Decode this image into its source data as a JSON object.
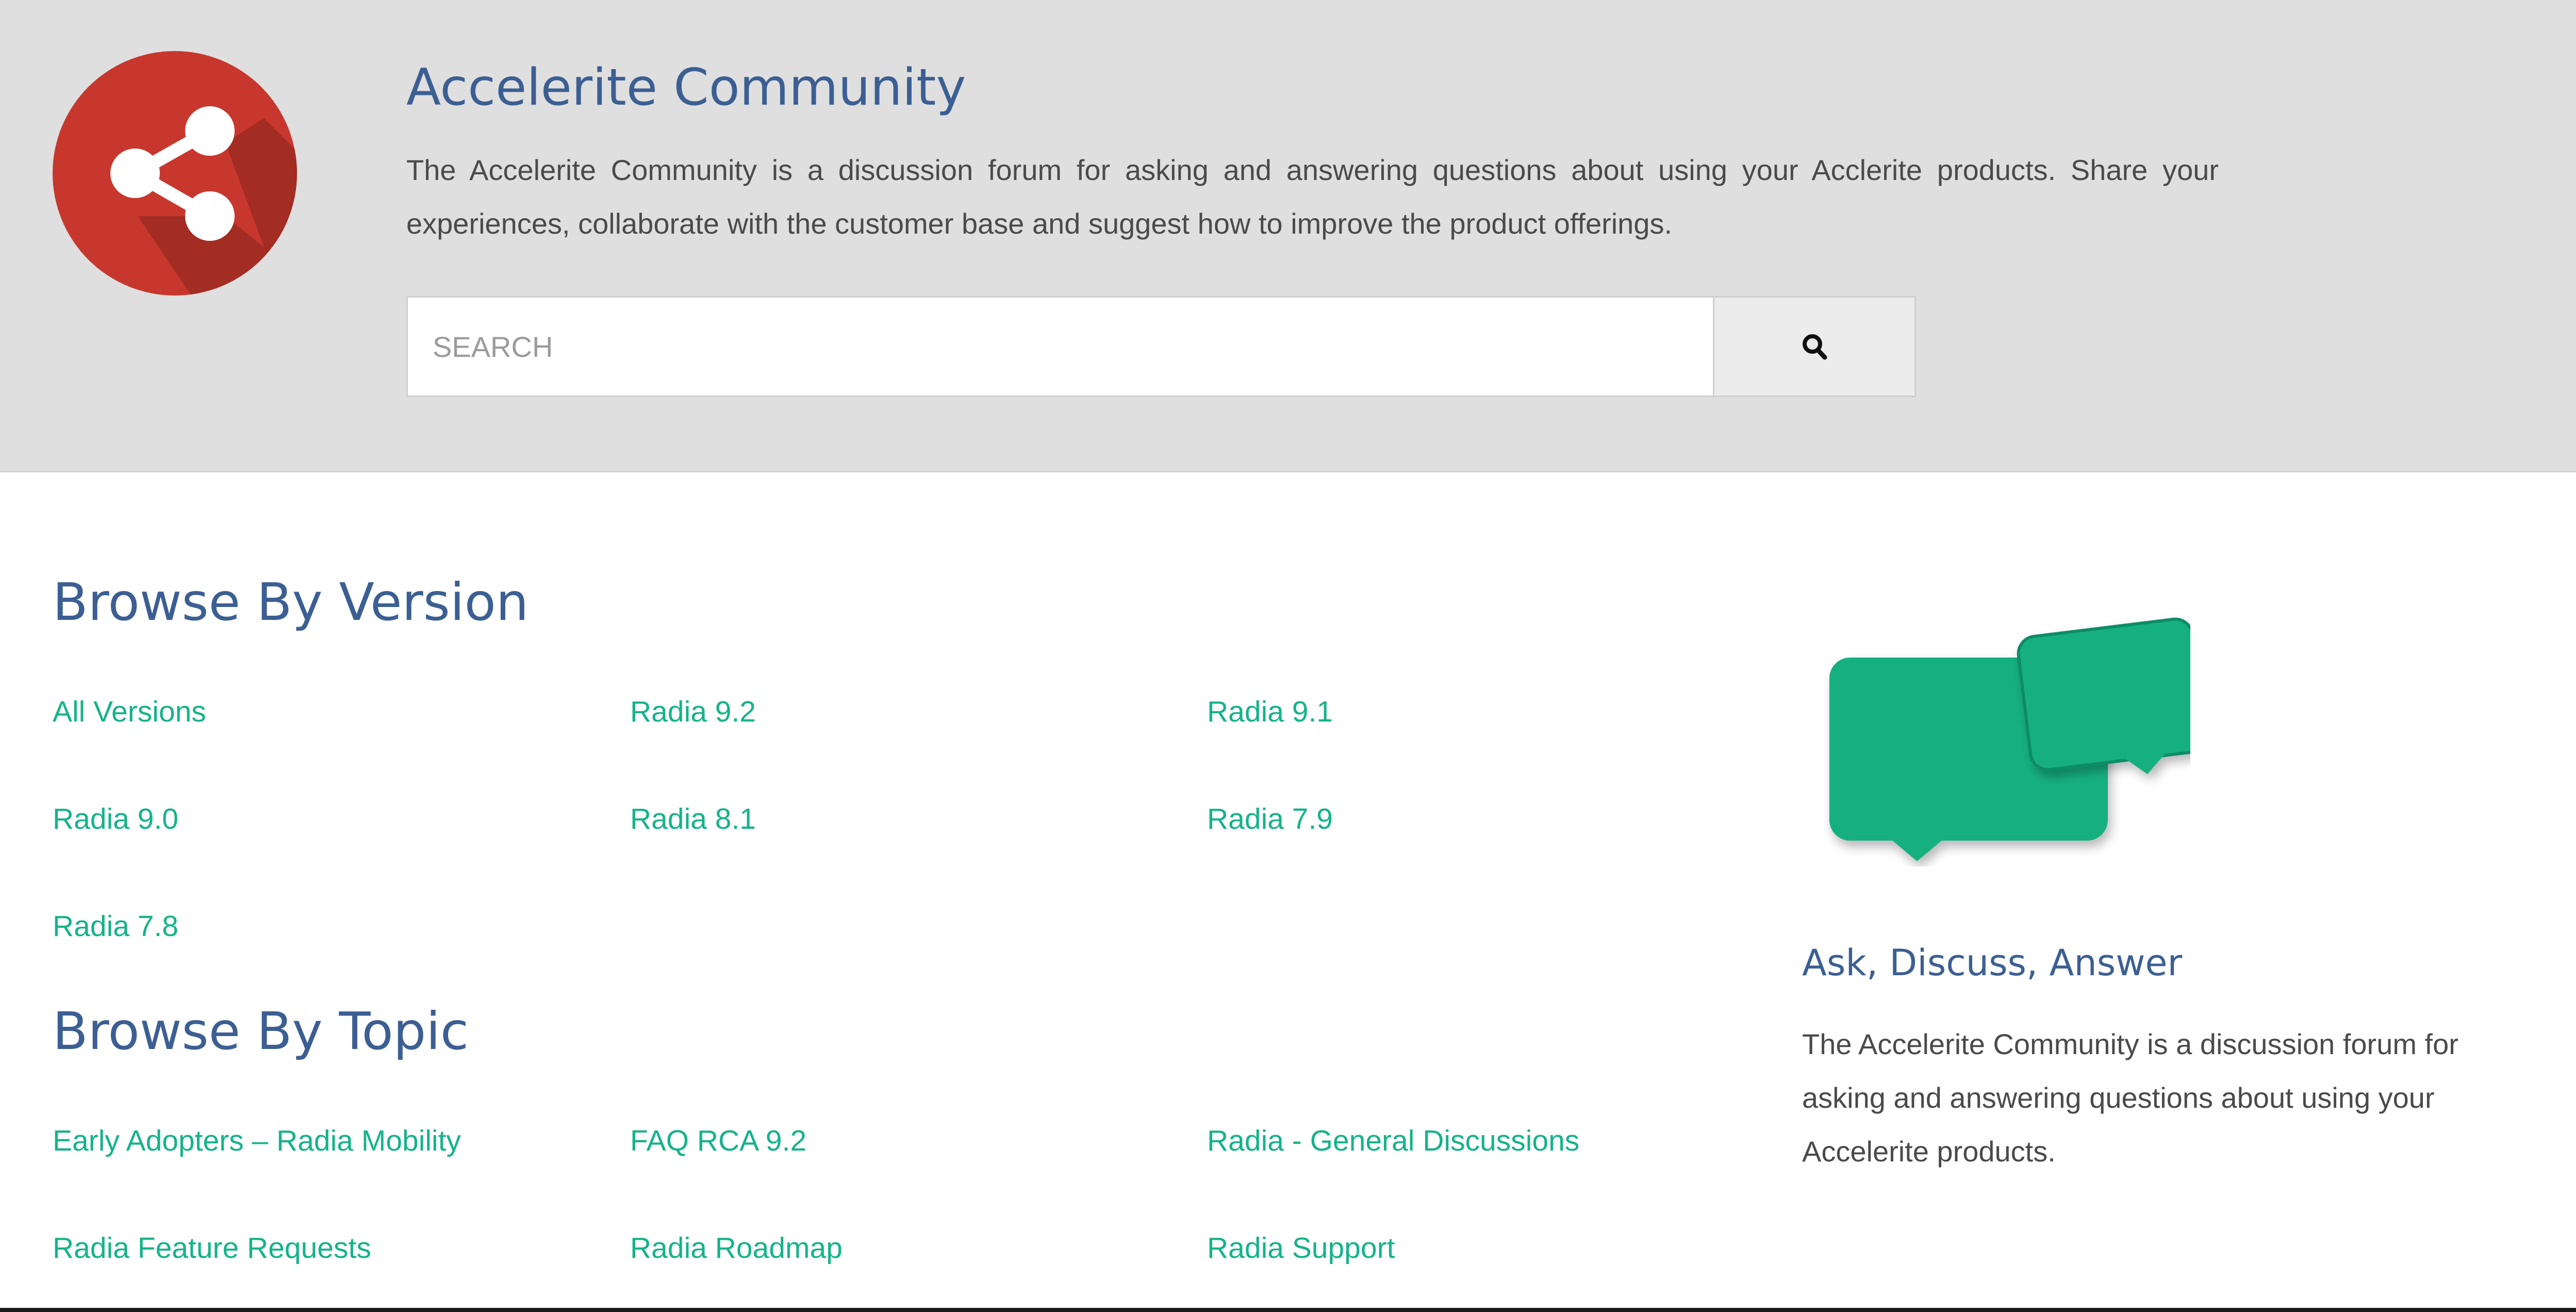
{
  "header": {
    "title": "Accelerite Community",
    "description": "The Accelerite Community is a discussion forum for asking and answering questions about using your Acclerite products. Share your experiences, collaborate with the customer base and suggest how to improve the product offerings.",
    "logo_icon": "share-icon",
    "logo_color": "#c8372d"
  },
  "search": {
    "placeholder": "SEARCH",
    "value": "",
    "button_icon": "search-icon"
  },
  "browse_version": {
    "title": "Browse By Version",
    "links": [
      "All Versions",
      "Radia 9.2",
      "Radia 9.1",
      "Radia 9.0",
      "Radia 8.1",
      "Radia 7.9",
      "Radia 7.8"
    ]
  },
  "browse_topic": {
    "title": "Browse By Topic",
    "links": [
      "Early Adopters – Radia Mobility",
      "FAQ RCA 9.2",
      "Radia - General Discussions",
      "Radia Feature Requests",
      "Radia Roadmap",
      "Radia Support"
    ]
  },
  "sidebar": {
    "icon": "chat-bubbles-icon",
    "title": "Ask, Discuss, Answer",
    "description": "The Accelerite Community is a discussion forum for asking and answering questions about using your Accelerite products."
  },
  "colors": {
    "heading": "#3c5f93",
    "link": "#15b38a",
    "hero_background": "#dfdfdf",
    "chat_green": "#15b07e"
  }
}
